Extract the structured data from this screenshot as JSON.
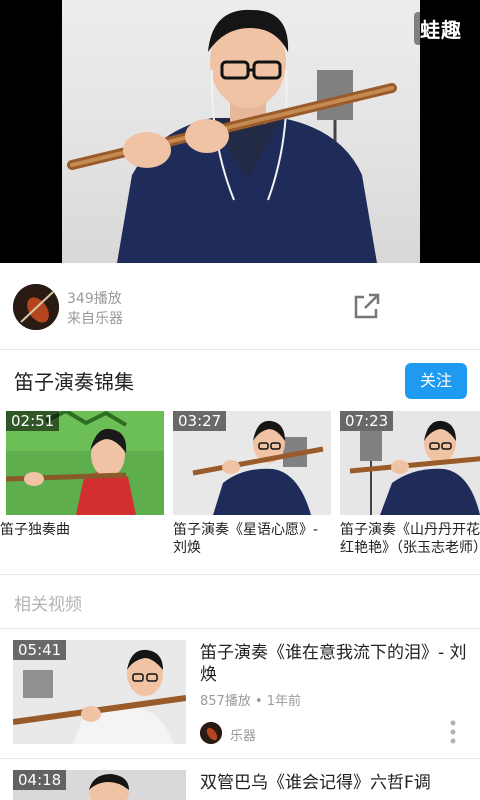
{
  "player": {
    "watermark": "蛙趣"
  },
  "uploader": {
    "play_count": "349播放",
    "source": "来自乐器"
  },
  "collection": {
    "title": "笛子演奏锦集",
    "follow_label": "关注",
    "items": [
      {
        "duration": "02:51",
        "title": "笛子独奏曲"
      },
      {
        "duration": "03:27",
        "title": "笛子演奏《星语心愿》- 刘焕"
      },
      {
        "duration": "07:23",
        "title": "笛子演奏《山丹丹开花红艳艳》（张玉志老师）"
      }
    ]
  },
  "related": {
    "section_title": "相关视频",
    "items": [
      {
        "duration": "05:41",
        "title": "笛子演奏《谁在意我流下的泪》- 刘焕",
        "meta": "857播放 • 1年前",
        "source": "乐器"
      },
      {
        "duration": "04:18",
        "title": "双管巴乌《谁会记得》六哲F调",
        "meta": "",
        "source": ""
      }
    ]
  }
}
